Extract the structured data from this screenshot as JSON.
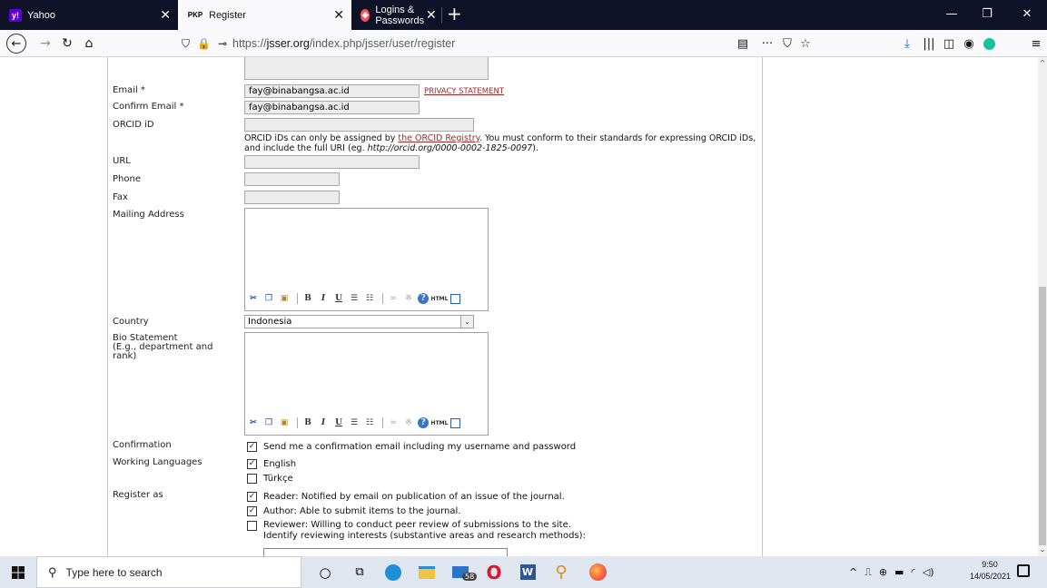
{
  "browser": {
    "tabs": [
      {
        "title": "Yahoo",
        "favicon": "y!",
        "active": false
      },
      {
        "title": "Register",
        "favicon": "PKP",
        "active": true
      },
      {
        "title": "Logins & Passwords",
        "favicon": "lock",
        "active": false
      }
    ],
    "url_prefix": "https://",
    "url_host": "jsser.org",
    "url_path": "/index.php/jsser/user/register"
  },
  "form": {
    "email_label": "Email *",
    "email_value": "fay@binabangsa.ac.id",
    "privacy_link": "PRIVACY STATEMENT",
    "confirm_email_label": "Confirm Email *",
    "confirm_email_value": "fay@binabangsa.ac.id",
    "orcid_label": "ORCID iD",
    "orcid_value": "",
    "orcid_help_pre": "ORCID iDs can only be assigned by ",
    "orcid_help_link": "the ORCID Registry",
    "orcid_help_mid": ". You must conform to their standards for expressing ORCID iDs, and include the full URI (eg. ",
    "orcid_help_example": "http://orcid.org/0000-0002-1825-0097",
    "orcid_help_post": ").",
    "url_label": "URL",
    "phone_label": "Phone",
    "fax_label": "Fax",
    "mailing_label": "Mailing Address",
    "country_label": "Country",
    "country_value": "Indonesia",
    "bio_label_1": "Bio Statement",
    "bio_label_2": "(E.g., department and",
    "bio_label_3": "rank)",
    "confirmation_label": "Confirmation",
    "confirmation_text": "Send me a confirmation email including my username and password",
    "confirmation_checked": true,
    "languages_label": "Working Languages",
    "languages": [
      {
        "name": "English",
        "checked": true
      },
      {
        "name": "Türkçe",
        "checked": false
      }
    ],
    "register_label": "Register as",
    "roles": [
      {
        "text": "Reader: Notified by email on publication of an issue of the journal.",
        "checked": true
      },
      {
        "text": "Author: Able to submit items to the journal.",
        "checked": true
      },
      {
        "text": "Reviewer: Willing to conduct peer review of submissions to the site.",
        "checked": false
      }
    ],
    "reviewer_interests": "Identify reviewing interests (substantive areas and research methods):"
  },
  "taskbar": {
    "search_placeholder": "Type here to search",
    "mail_badge": "58",
    "time": "9:50",
    "date": "14/05/2021"
  }
}
